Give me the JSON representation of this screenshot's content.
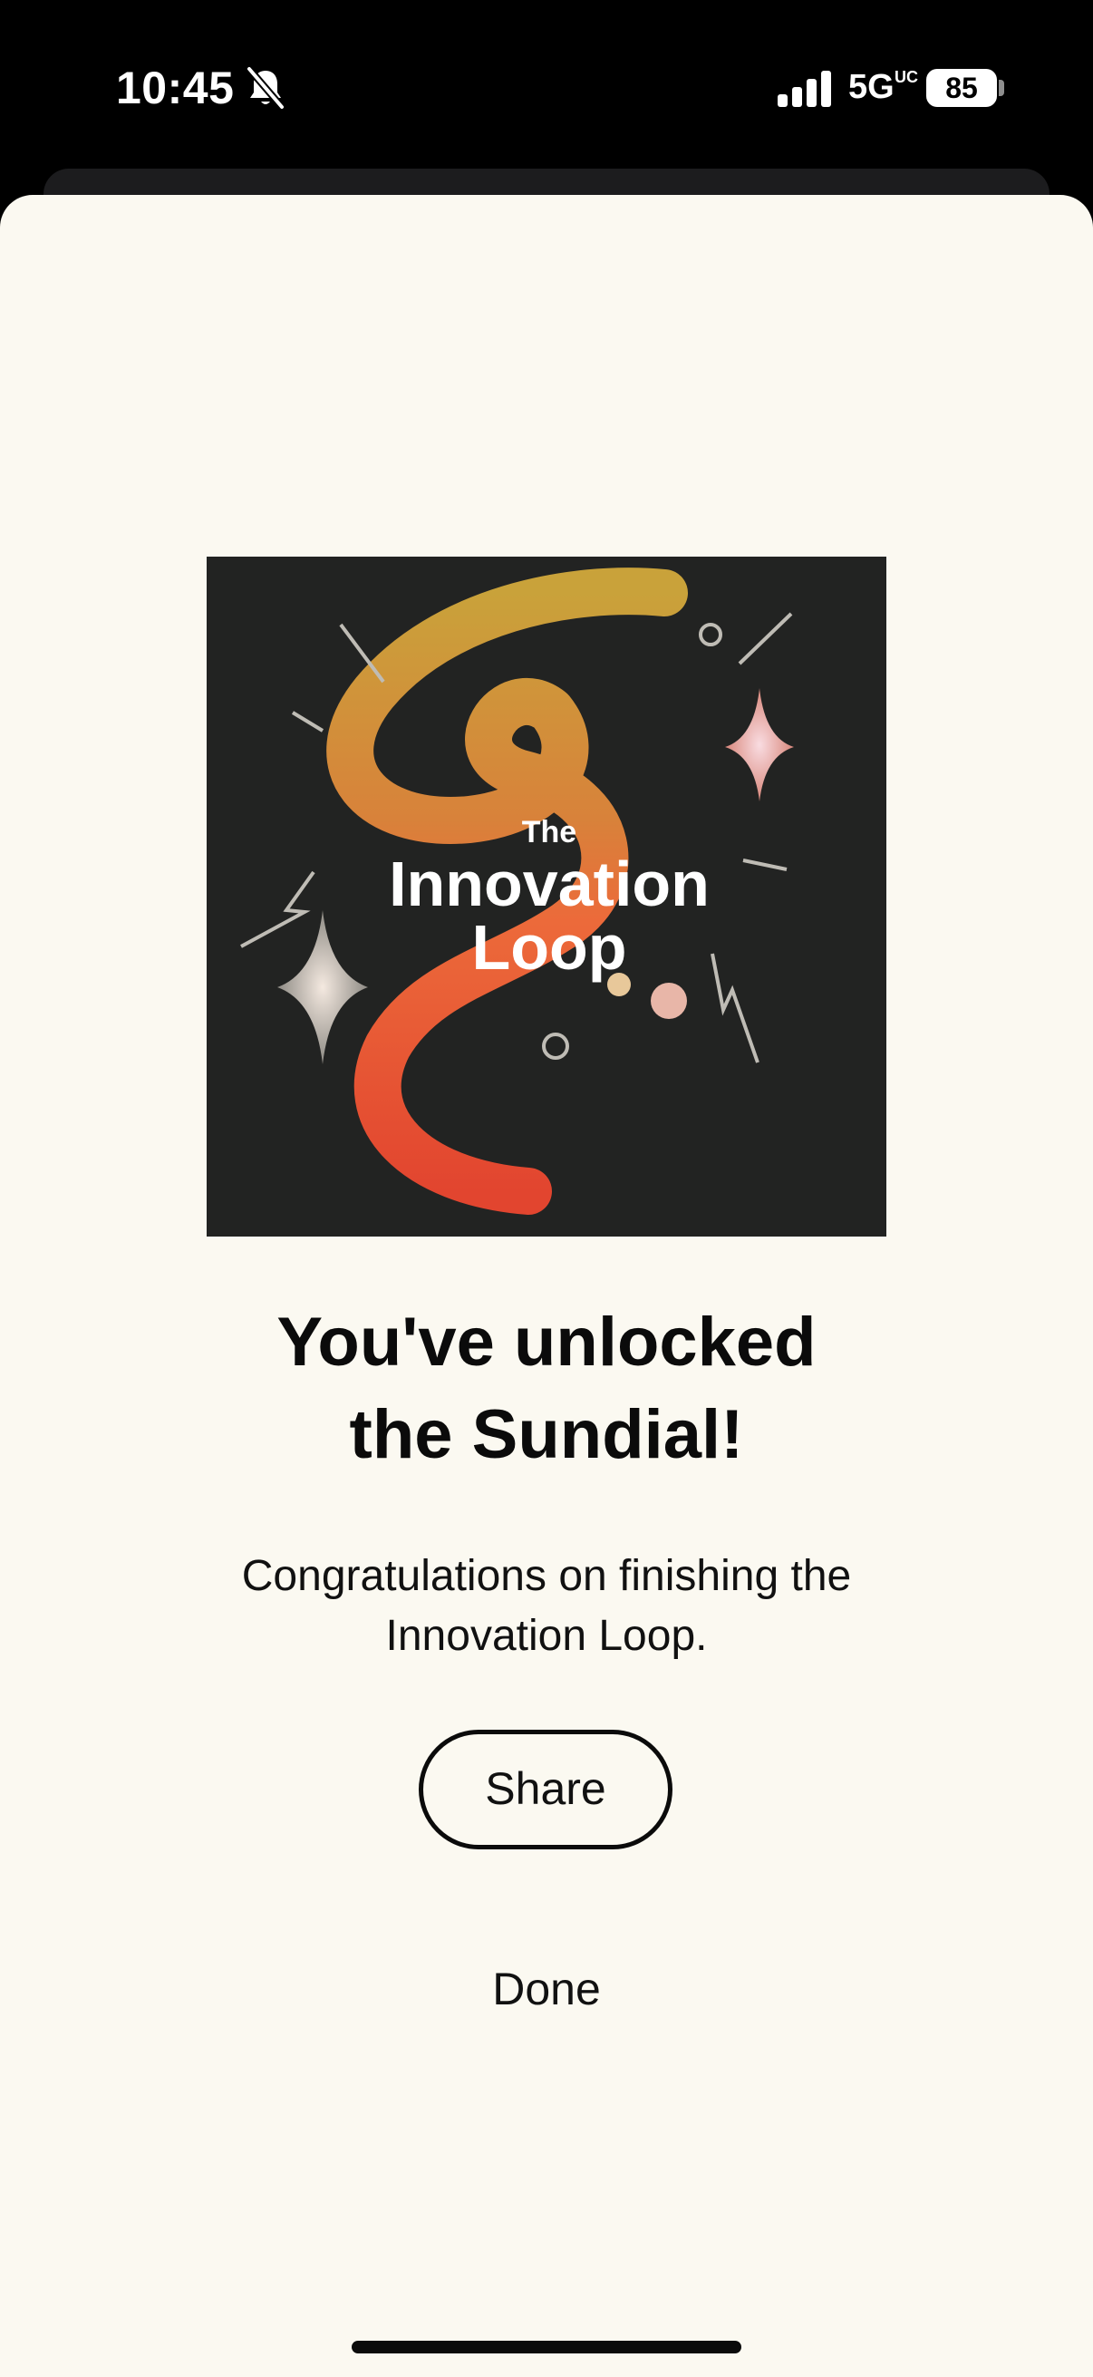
{
  "status_bar": {
    "time": "10:45",
    "network": "5G",
    "network_badge": "UC",
    "battery": "85"
  },
  "cover": {
    "title_line1": "The",
    "title_line2": "Innovation",
    "title_line3": "Loop"
  },
  "modal": {
    "headline_line1": "You've unlocked",
    "headline_line2": "the Sundial!",
    "message_line1": "Congratulations on finishing the",
    "message_line2": "Innovation Loop.",
    "share_label": "Share",
    "done_label": "Done"
  },
  "colors": {
    "sheet_background": "#fbf9f1",
    "cover_background": "#222322",
    "loop_gold": "#c9a23a",
    "loop_orange": "#ec6a3a",
    "loop_red": "#e2452f",
    "text": "#0b0b0b"
  },
  "icons": {
    "silent": "bell-slash-icon",
    "signal": "cellular-signal-icon",
    "battery": "battery-icon"
  }
}
